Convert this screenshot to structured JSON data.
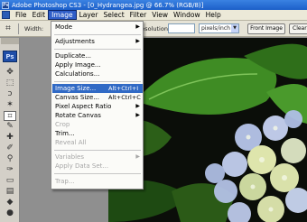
{
  "window": {
    "title": "Adobe Photoshop CS3 - [0_Hydrangea.jpg @ 66.7% (RGB/8)]"
  },
  "menubar": {
    "items": [
      "File",
      "Edit",
      "Image",
      "Layer",
      "Select",
      "Filter",
      "View",
      "Window",
      "Help"
    ],
    "active": "Image"
  },
  "options": {
    "width_label": "Width:",
    "resolution_label": "Resolution:",
    "resolution_value": "",
    "units": "pixels/inch",
    "front_image_button": "Front Image",
    "clear_button": "Clear"
  },
  "toolbox": {
    "logo": "Ps"
  },
  "image_menu": {
    "mode": "Mode",
    "adjustments": "Adjustments",
    "duplicate": "Duplicate...",
    "apply_image": "Apply Image...",
    "calculations": "Calculations...",
    "image_size": "Image Size...",
    "image_size_shortcut": "Alt+Ctrl+I",
    "canvas_size": "Canvas Size...",
    "canvas_size_shortcut": "Alt+Ctrl+C",
    "pixel_aspect_ratio": "Pixel Aspect Ratio",
    "rotate_canvas": "Rotate Canvas",
    "crop": "Crop",
    "trim": "Trim...",
    "reveal_all": "Reveal All",
    "variables": "Variables",
    "apply_data_set": "Apply Data Set...",
    "trap": "Trap..."
  },
  "colors": {
    "menu_highlight": "#316ac5",
    "titlebar": "#2a6fd8",
    "leaf_green": "#4f9a2a",
    "flower_blue": "#b9c8ec",
    "flower_cream": "#e9f0b8"
  }
}
